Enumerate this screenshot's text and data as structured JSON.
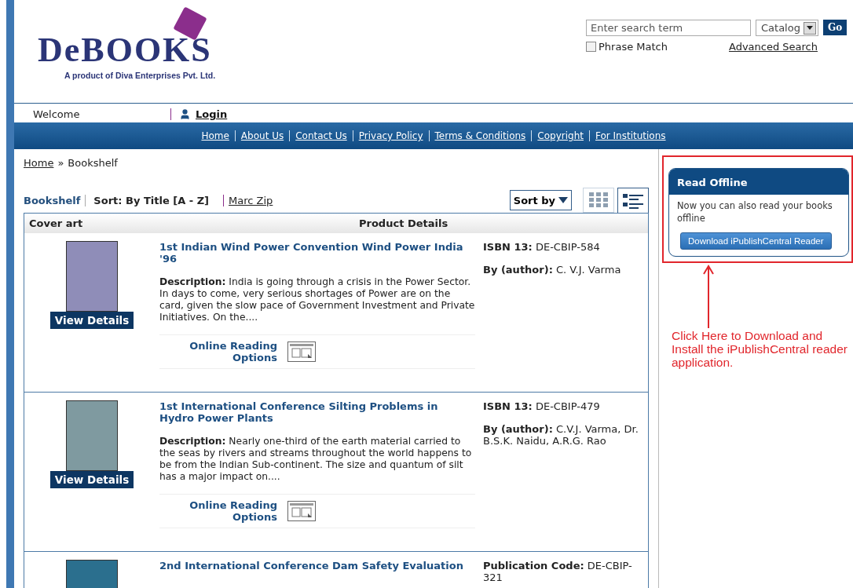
{
  "header": {
    "logo": {
      "name": "DeBOOKS",
      "tagline": "A product of Diva Enterprises Pvt. Ltd."
    },
    "search": {
      "placeholder": "Enter search term",
      "scope": "Catalog",
      "go": "Go",
      "phrase_match": {
        "label": "Phrase Match",
        "checked": false
      },
      "advanced": "Advanced Search"
    }
  },
  "user_bar": {
    "welcome": "Welcome",
    "login": "Login"
  },
  "nav": [
    "Home",
    "About Us",
    "Contact Us",
    "Privacy Policy",
    "Terms & Conditions",
    "Copyright",
    "For Institutions"
  ],
  "breadcrumb": {
    "items": [
      "Home",
      "Bookshelf"
    ],
    "separator": "»"
  },
  "toolbar": {
    "bookshelf": "Bookshelf",
    "sort_label": "Sort: By Title [A - Z]",
    "marc": "Marc Zip",
    "sort_button": "Sort by",
    "views": [
      {
        "kind": "grid",
        "selected": false
      },
      {
        "kind": "list",
        "selected": true
      }
    ]
  },
  "table": {
    "columns": [
      "Cover art",
      "Product Details"
    ],
    "rows": [
      {
        "title": "1st Indian Wind Power Convention Wind Power India '96",
        "description": "**Description:** India is going through a crisis in the Power Sector. In days to come, very serious shortages of Power are on the card, given the slow pace of Government Investment and Private Initiatives. On the....",
        "details": [
          {
            "label": "ISBN 13:",
            "value": "DE-CBIP-584"
          },
          {
            "label": "By (author):",
            "value": "C. V.J. Varma"
          }
        ],
        "view_details": "View Details",
        "reading": "Online Reading Options"
      },
      {
        "title": "1st International Conference Silting Problems in Hydro Power Plants",
        "description": "**Description:** Nearly one-third of the earth material carried to the seas by rivers and streams throughout the world happens to be from the Indian Sub-continent. The size and quantum of silt has a major impact on....",
        "details": [
          {
            "label": "ISBN 13:",
            "value": "DE-CBIP-479"
          },
          {
            "label": "By (author):",
            "value": "C.V.J. Varma, Dr. B.S.K. Naidu, A.R.G. Rao"
          }
        ],
        "view_details": "View Details",
        "reading": "Online Reading Options"
      },
      {
        "title": "2nd International Conference Dam Safety Evaluation",
        "details": [
          {
            "label": "Publication Code:",
            "value": "DE-CBIP-321"
          }
        ]
      }
    ]
  },
  "sidebar": {
    "title": "Read Offline",
    "text": "Now you can also read your books offline",
    "button": "Download iPublishCentral Reader"
  },
  "annotation": {
    "text": "Click Here to Download and Install the iPublishCentral reader application."
  }
}
